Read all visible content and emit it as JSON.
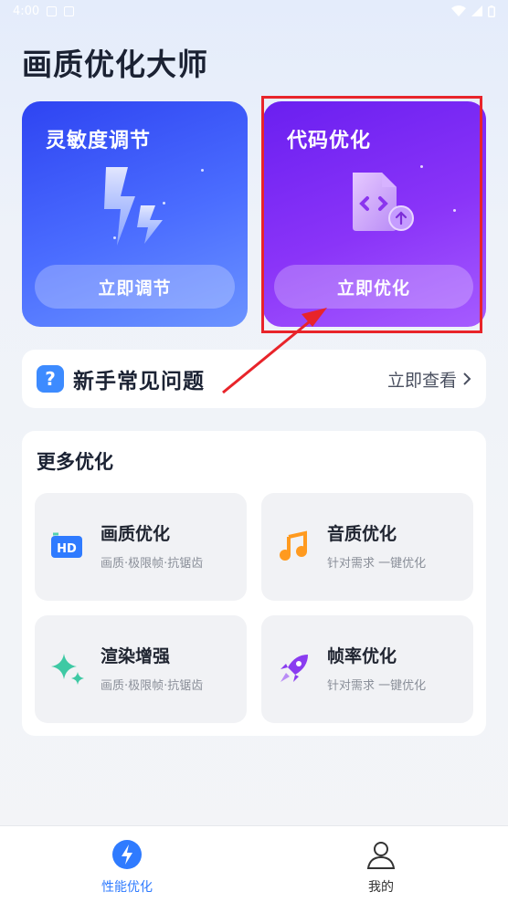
{
  "status": {
    "time": "4:00"
  },
  "app_title": "画质优化大师",
  "cards": [
    {
      "title": "灵敏度调节",
      "button": "立即调节"
    },
    {
      "title": "代码优化",
      "button": "立即优化"
    }
  ],
  "faq": {
    "title": "新手常见问题",
    "link": "立即查看"
  },
  "more": {
    "title": "更多优化",
    "tiles": [
      {
        "name": "画质优化",
        "sub": "画质·极限帧·抗锯齿"
      },
      {
        "name": "音质优化",
        "sub": "针对需求 一键优化"
      },
      {
        "name": "渲染增强",
        "sub": "画质·极限帧·抗锯齿"
      },
      {
        "name": "帧率优化",
        "sub": "针对需求 一键优化"
      }
    ]
  },
  "nav": [
    {
      "label": "性能优化",
      "active": true
    },
    {
      "label": "我的",
      "active": false
    }
  ],
  "colors": {
    "accent": "#2f7bff",
    "annotation": "#e8242a"
  }
}
